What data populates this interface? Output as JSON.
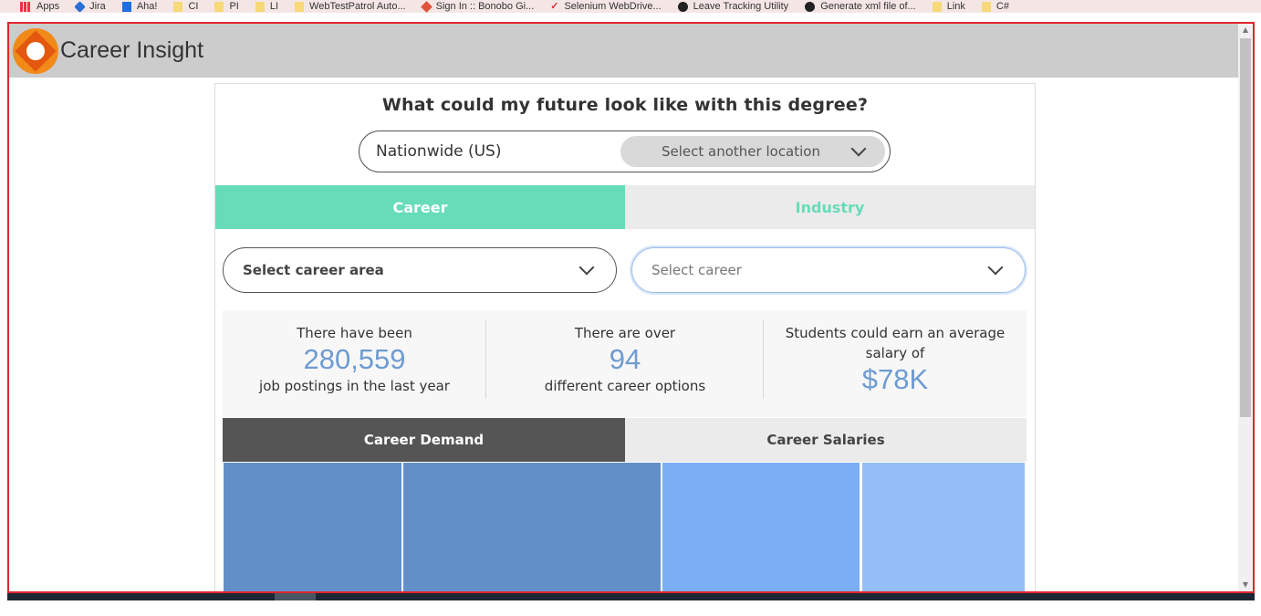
{
  "bookmarks": [
    {
      "label": "Apps",
      "icon": "apps-icon"
    },
    {
      "label": "Jira",
      "icon": "jira-icon"
    },
    {
      "label": "Aha!",
      "icon": "aha-icon"
    },
    {
      "label": "CI",
      "icon": "folder-icon"
    },
    {
      "label": "PI",
      "icon": "folder-icon"
    },
    {
      "label": "LI",
      "icon": "folder-icon"
    },
    {
      "label": "WebTestPatrol Auto...",
      "icon": "folder-icon"
    },
    {
      "label": "Sign In :: Bonobo Gi...",
      "icon": "git-icon"
    },
    {
      "label": "Selenium WebDrive...",
      "icon": "selenium-icon"
    },
    {
      "label": "Leave Tracking Utility",
      "icon": "globe-icon"
    },
    {
      "label": "Generate xml file of...",
      "icon": "github-icon"
    },
    {
      "label": "Link",
      "icon": "folder-icon"
    },
    {
      "label": "C#",
      "icon": "folder-icon"
    }
  ],
  "app": {
    "title": "Career Insight"
  },
  "question": "What could my future look like with this degree?",
  "location": {
    "current": "Nationwide (US)",
    "select_label": "Select another location"
  },
  "tabs": [
    {
      "label": "Career",
      "active": true
    },
    {
      "label": "Industry",
      "active": false
    }
  ],
  "selects": {
    "career_area": "Select career area",
    "career": "Select career"
  },
  "stats": [
    {
      "pre": "There have been",
      "value": "280,559",
      "post": "job postings in the last year"
    },
    {
      "pre": "There are over",
      "value": "94",
      "post": "different career options"
    },
    {
      "pre": "Students could earn an average salary of",
      "value": "$78K",
      "post": ""
    }
  ],
  "subtabs": [
    {
      "label": "Career Demand",
      "active": true
    },
    {
      "label": "Career Salaries",
      "active": false
    }
  ],
  "colors": {
    "accent": "#67dcb9",
    "stat_value": "#6e9bd1",
    "frame_border": "#e0262e",
    "treemap": [
      "#638fc9",
      "#638fc9",
      "#7aaff3",
      "#94bff8"
    ]
  }
}
